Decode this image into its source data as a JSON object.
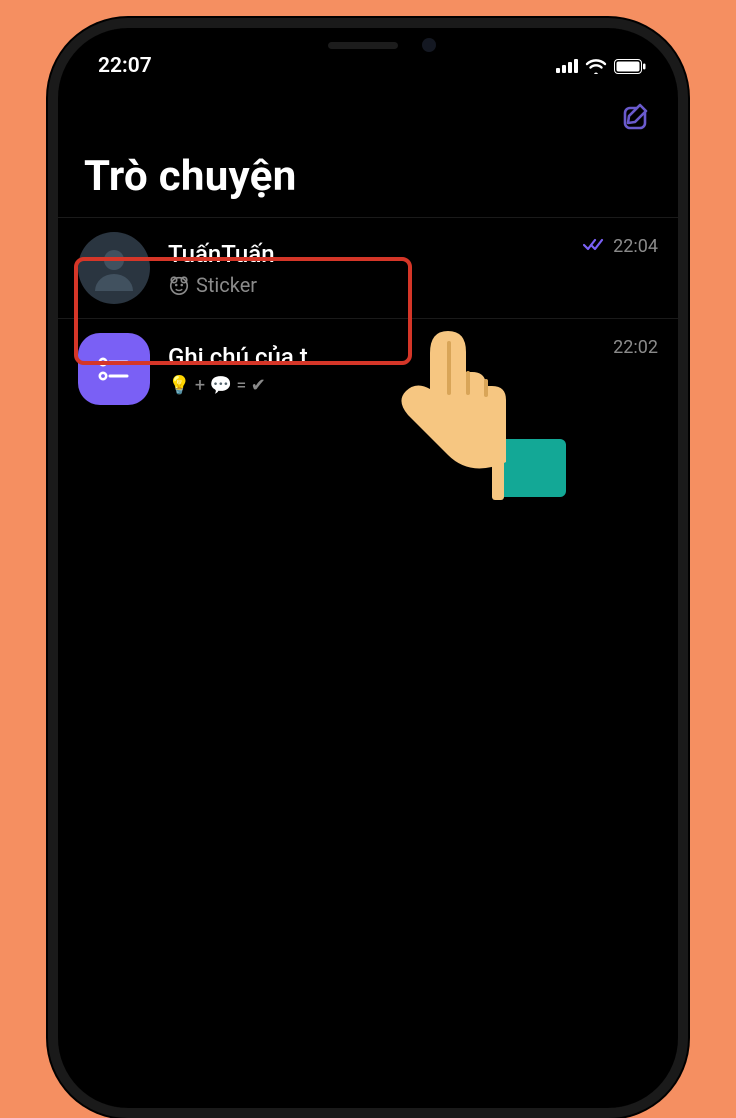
{
  "status": {
    "time": "22:07"
  },
  "header": {
    "title": "Trò chuyện"
  },
  "chats": [
    {
      "name": "TuấnTuấn",
      "preview_label": "Sticker",
      "time": "22:04",
      "read": true,
      "avatar_kind": "person",
      "highlighted": true
    },
    {
      "name": "Ghi chú của t",
      "preview_label": "💡 + 💬 = ✔",
      "time": "22:02",
      "read": false,
      "avatar_kind": "notes",
      "highlighted": false
    }
  ]
}
